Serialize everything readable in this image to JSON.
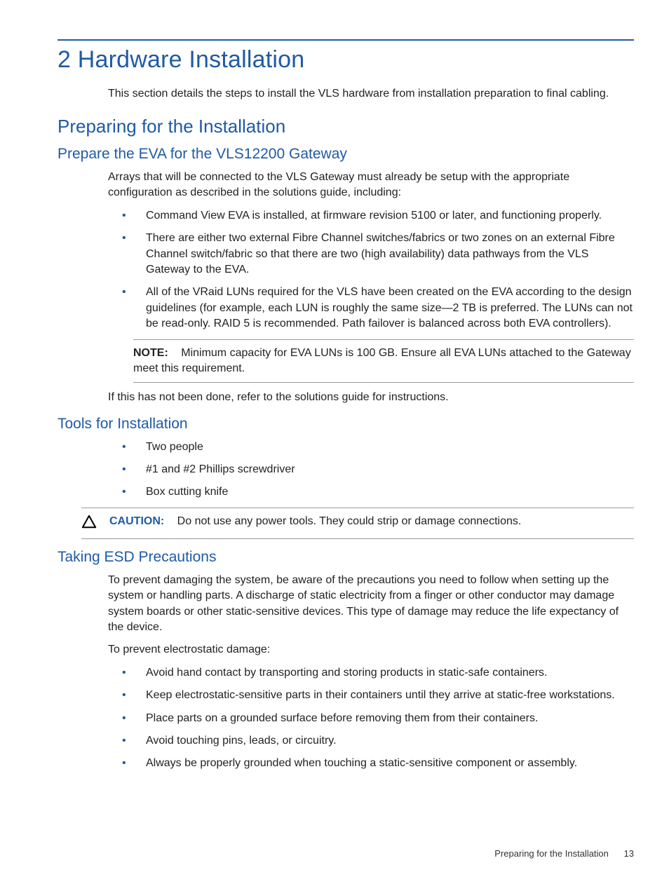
{
  "chapter": {
    "number": "2",
    "title": "Hardware Installation"
  },
  "intro": "This section details the steps to install the VLS hardware from installation preparation to final cabling.",
  "section1": {
    "title": "Preparing for the Installation",
    "sub1": {
      "title": "Prepare the EVA for the VLS12200 Gateway",
      "para1": "Arrays that will be connected to the VLS Gateway must already be setup with the appropriate configuration as described in the solutions guide, including:",
      "bullets": [
        "Command View EVA is installed, at firmware revision 5100 or later, and functioning properly.",
        "There are either two external Fibre Channel switches/fabrics or two zones on an external Fibre Channel switch/fabric so that there are two (high availability) data pathways from the VLS Gateway to the EVA.",
        "All of the VRaid LUNs required for the VLS have been created on the EVA according to the design guidelines (for example, each LUN is roughly the same size—2 TB is preferred. The LUNs can not be read-only. RAID 5 is recommended. Path failover is balanced across both EVA controllers)."
      ],
      "note_label": "NOTE:",
      "note_text": "Minimum capacity for EVA LUNs is 100 GB. Ensure all EVA LUNs attached to the Gateway meet this requirement.",
      "after_note": "If this has not been done, refer to the solutions guide for instructions."
    },
    "sub2": {
      "title": "Tools for Installation",
      "bullets": [
        "Two people",
        "#1 and #2 Phillips screwdriver",
        "Box cutting knife"
      ],
      "caution_label": "CAUTION:",
      "caution_text": "Do not use any power tools. They could strip or damage connections."
    },
    "sub3": {
      "title": "Taking ESD Precautions",
      "para1": "To prevent damaging the system, be aware of the precautions you need to follow when setting up the system or handling parts. A discharge of static electricity from a finger or other conductor may damage system boards or other static-sensitive devices. This type of damage may reduce the life expectancy of the device.",
      "para2": "To prevent electrostatic damage:",
      "bullets": [
        "Avoid hand contact by transporting and storing products in static-safe containers.",
        "Keep electrostatic-sensitive parts in their containers until they arrive at static-free workstations.",
        "Place parts on a grounded surface before removing them from their containers.",
        "Avoid touching pins, leads, or circuitry.",
        "Always be properly grounded when touching a static-sensitive component or assembly."
      ]
    }
  },
  "footer": {
    "text": "Preparing for the Installation",
    "page": "13"
  }
}
